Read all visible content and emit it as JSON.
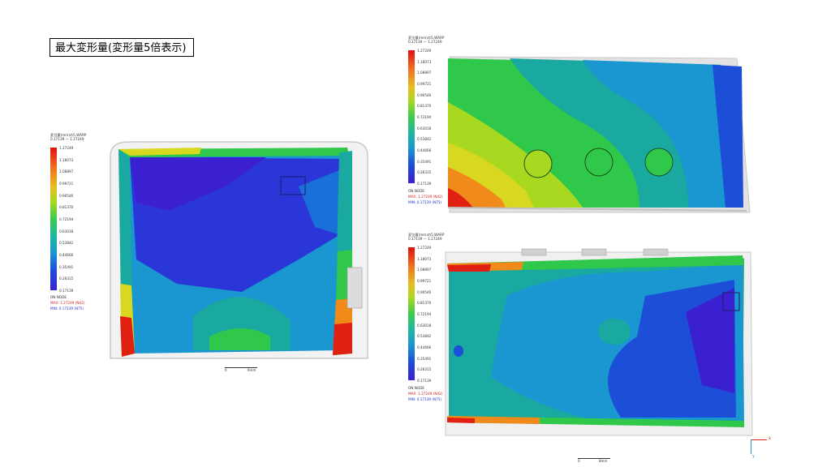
{
  "title": "最大変形量(変形量5倍表示)",
  "legend": {
    "header": "変位量(mm)の5,WARP",
    "range": "0.17139 — 1.27249",
    "ticks": [
      "1.27249",
      "1.18073",
      "1.08897",
      "0.99721",
      "0.90546",
      "0.81370",
      "0.72194",
      "0.63018",
      "0.53842",
      "0.44666",
      "0.35491",
      "0.26315",
      "0.17139"
    ],
    "on_node": "ON NODE",
    "max_line": "MAX: 1.27249 (N42)",
    "min_line": "MIN: 0.17139 (N75)"
  },
  "scale_bars": {
    "left": [
      "0",
      "6mm"
    ],
    "bottom": [
      "0",
      "8mm"
    ]
  },
  "axis_labels": [
    "x",
    "y"
  ],
  "colors": {
    "red": "#e02010",
    "orange": "#f08a1a",
    "yellow": "#d8d820",
    "green": "#2fc84a",
    "teal": "#19a9a0",
    "cyan": "#1896cc",
    "blue": "#1d4ed8",
    "deepblue": "#3f1fd0",
    "frame": "#c8c8c8"
  }
}
